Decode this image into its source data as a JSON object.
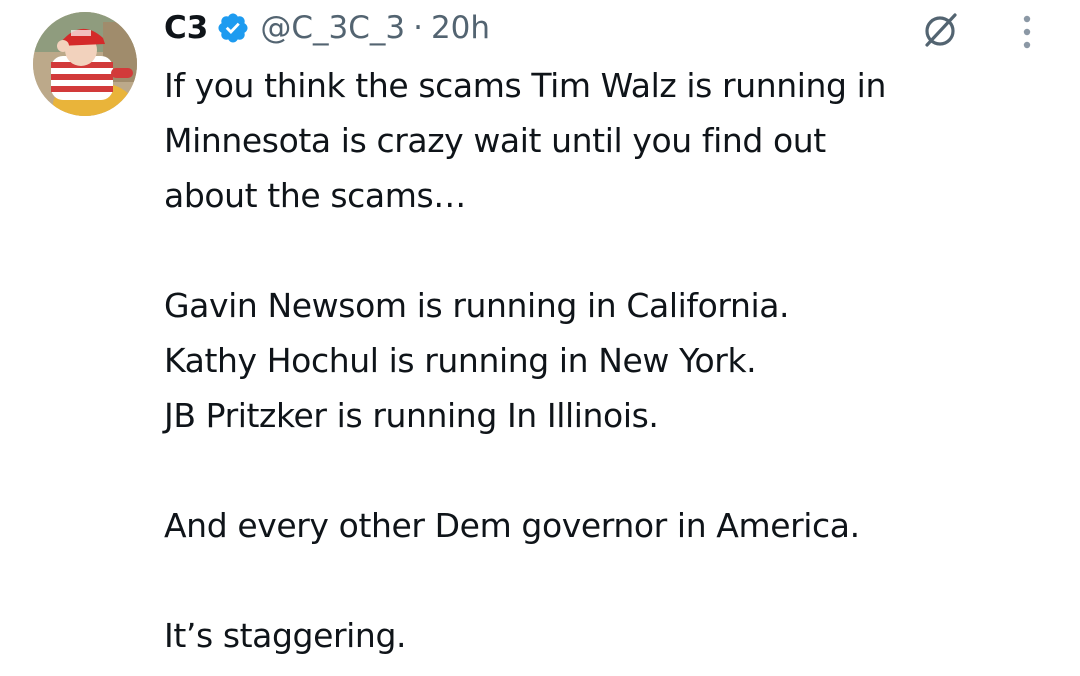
{
  "author": {
    "display_name": "C3",
    "handle": "@C_3C_3",
    "separator": "·",
    "timestamp": "20h",
    "avatar_icon": "avatar-photo",
    "verified_icon": "verified-badge-icon",
    "verified_color": "#1d9bf0"
  },
  "actions": {
    "grok_icon": "grok-icon",
    "more_icon": "more-options-icon"
  },
  "tweet": {
    "lines": [
      "If you think the scams Tim Walz is running in",
      "Minnesota is crazy wait until you find out",
      "about the scams…",
      "Gavin Newsom is running in California.",
      "Kathy Hochul is running in New York.",
      "JB Pritzker is running In Illinois.",
      "And every other Dem governor in America.",
      "It’s staggering."
    ]
  },
  "colors": {
    "text": "#0f1419",
    "secondary": "#536471",
    "background": "#ffffff"
  }
}
